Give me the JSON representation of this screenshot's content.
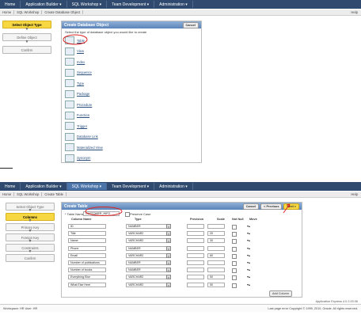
{
  "top": {
    "tabs": [
      {
        "label": "Home"
      },
      {
        "label": "Application Builder ▾"
      },
      {
        "label": "SQL Workshop ▾"
      },
      {
        "label": "Team Development ▾"
      },
      {
        "label": "Administration ▾"
      }
    ],
    "crumbs": [
      "Home",
      "SQL Workshop",
      "Create Database Object"
    ],
    "help": "Help",
    "steps": [
      "Select Object Type",
      "Define Object",
      "Confirm"
    ],
    "panel_title": "Create Database Object",
    "cancel": "Cancel",
    "instruction": "Select the type of database object you would like to create",
    "objects": [
      "Table",
      "View",
      "Index",
      "Sequence",
      "Type",
      "Package",
      "Procedure",
      "Function",
      "Trigger",
      "Database Link",
      "Materialized View",
      "Synonym"
    ]
  },
  "bottom": {
    "tabs": [
      {
        "label": "Home"
      },
      {
        "label": "Application Builder ▾"
      },
      {
        "label": "SQL Workshop ▾"
      },
      {
        "label": "Team Development ▾"
      },
      {
        "label": "Administration ▾"
      }
    ],
    "crumbs": [
      "Home",
      "SQL Workshop",
      "Create Table"
    ],
    "help": "Help",
    "steps": [
      "Select Object Type",
      "Columns",
      "Primary Key",
      "Foreign Key",
      "Constraints",
      "Confirm"
    ],
    "panel_title": "Create Table",
    "buttons": {
      "cancel": "Cancel",
      "previous": "< Previous",
      "next": "Next >"
    },
    "table_name_label": "* Table Name",
    "table_name_value": "CUSTOMER_INFO",
    "preserve_case": "Preserve Case",
    "headers": {
      "column": "Column Name",
      "type": "Type",
      "precision": "Precision",
      "scale": "Scale",
      "not_null": "Not Null",
      "move": "Move"
    },
    "rows": [
      {
        "name": "ID",
        "type": "NUMBER",
        "precision": "",
        "scale": ""
      },
      {
        "name": "Title",
        "type": "VARCHAR2",
        "precision": "",
        "scale": "20"
      },
      {
        "name": "Name",
        "type": "VARCHAR2",
        "precision": "",
        "scale": "30"
      },
      {
        "name": "Phone",
        "type": "NUMBER",
        "precision": "",
        "scale": ""
      },
      {
        "name": "Email",
        "type": "VARCHAR2",
        "precision": "",
        "scale": "60"
      },
      {
        "name": "Number of publications",
        "type": "NUMBER",
        "precision": "",
        "scale": ""
      },
      {
        "name": "Number of books",
        "type": "NUMBER",
        "precision": "",
        "scale": ""
      },
      {
        "name": "Everything Else",
        "type": "VARCHAR2",
        "precision": "",
        "scale": "50"
      },
      {
        "name": "What Else Here",
        "type": "VARCHAR2",
        "precision": "",
        "scale": "50"
      }
    ],
    "add_column": "Add Column",
    "footer_left": "Workspace: HR   User: HR",
    "footer_right": "Last page error   Copyright © 1999, 2010, Oracle. All rights reserved.",
    "version": "Application Express 4.0.2.00.06"
  },
  "accent_color": "#f7d843"
}
